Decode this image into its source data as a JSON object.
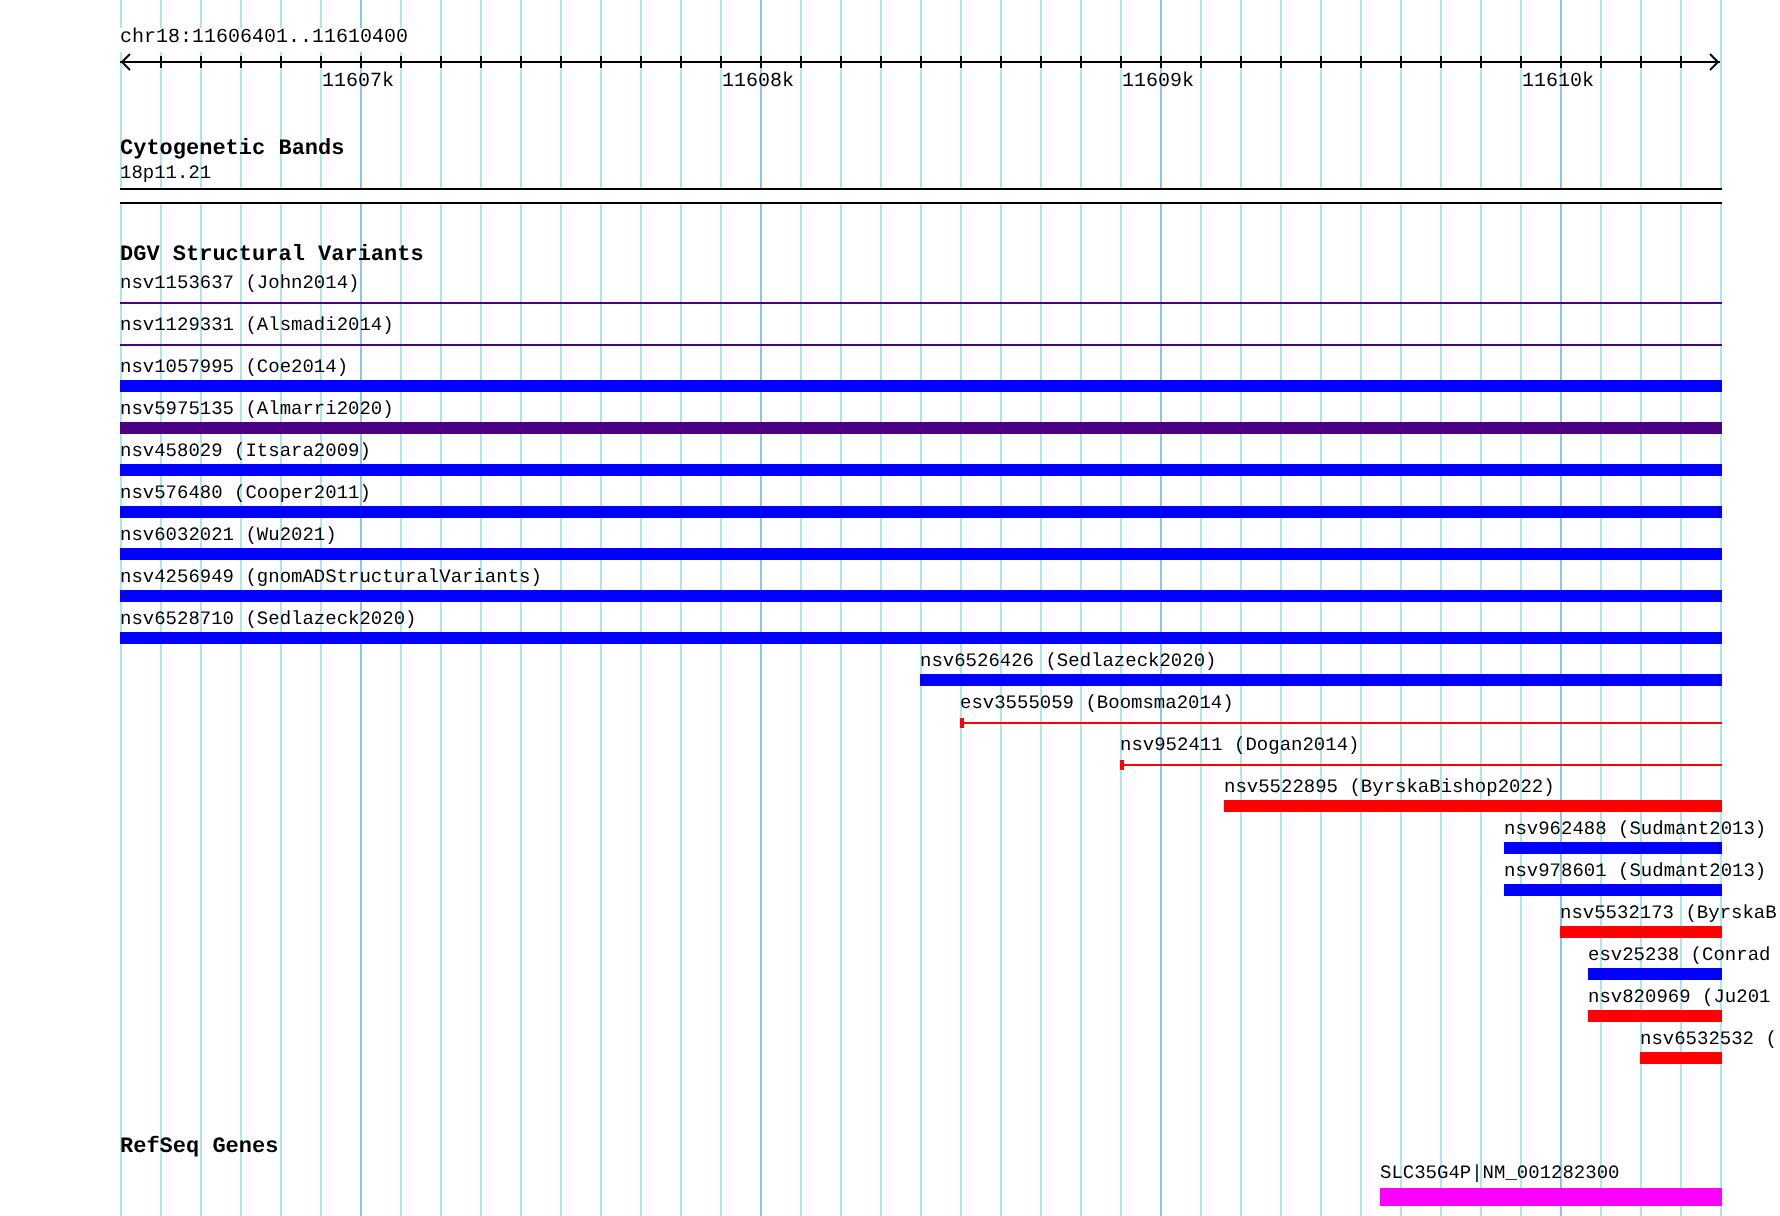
{
  "ruler": {
    "location": "chr18:11606401..11610400",
    "ticks": [
      "11607k",
      "11608k",
      "11609k",
      "11610k"
    ]
  },
  "tracks": [
    {
      "title": "Cytogenetic Bands",
      "kind": "cytoband",
      "features": [
        {
          "label": "18p11.21"
        }
      ]
    },
    {
      "title": "DGV Structural Variants",
      "kind": "variants",
      "features": [
        {
          "label": "nsv1153637 (John2014)",
          "kind": "line",
          "color": "#4b0082"
        },
        {
          "label": "nsv1129331 (Alsmadi2014)",
          "kind": "line",
          "color": "#4b0082"
        },
        {
          "label": "nsv1057995 (Coe2014)",
          "kind": "bar",
          "color": "#0000ff"
        },
        {
          "label": "nsv5975135 (Almarri2020)",
          "kind": "bar",
          "color": "#4b0082"
        },
        {
          "label": "nsv458029 (Itsara2009)",
          "kind": "bar",
          "color": "#0000ff"
        },
        {
          "label": "nsv576480 (Cooper2011)",
          "kind": "bar",
          "color": "#0000ff"
        },
        {
          "label": "nsv6032021 (Wu2021)",
          "kind": "bar",
          "color": "#0000ff"
        },
        {
          "label": "nsv4256949 (gnomADStructuralVariants)",
          "kind": "bar",
          "color": "#0000ff"
        },
        {
          "label": "nsv6528710 (Sedlazeck2020)",
          "kind": "bar",
          "color": "#0000ff"
        },
        {
          "label": "nsv6526426 (Sedlazeck2020)",
          "kind": "bar",
          "color": "#0000ff"
        },
        {
          "label": "esv3555059 (Boomsma2014)",
          "kind": "line",
          "color": "#ff0000"
        },
        {
          "label": "nsv952411 (Dogan2014)",
          "kind": "line",
          "color": "#ff0000"
        },
        {
          "label": "nsv5522895 (ByrskaBishop2022)",
          "kind": "bar",
          "color": "#ff0000"
        },
        {
          "label": "nsv962488 (Sudmant2013)",
          "kind": "bar",
          "color": "#0000ff"
        },
        {
          "label": "nsv978601 (Sudmant2013)",
          "kind": "bar",
          "color": "#0000ff"
        },
        {
          "label": "nsv5532173 (ByrskaB",
          "kind": "bar",
          "color": "#ff0000"
        },
        {
          "label": "esv25238 (Conrad",
          "kind": "bar",
          "color": "#0000ff"
        },
        {
          "label": "nsv820969 (Ju201",
          "kind": "bar",
          "color": "#ff0000"
        },
        {
          "label": "nsv6532532 (",
          "kind": "bar",
          "color": "#ff0000"
        }
      ]
    },
    {
      "title": "RefSeq Genes",
      "kind": "genes",
      "features": [
        {
          "label": "SLC35G4P|NM_001282300",
          "color": "#ff00ff"
        }
      ]
    }
  ]
}
